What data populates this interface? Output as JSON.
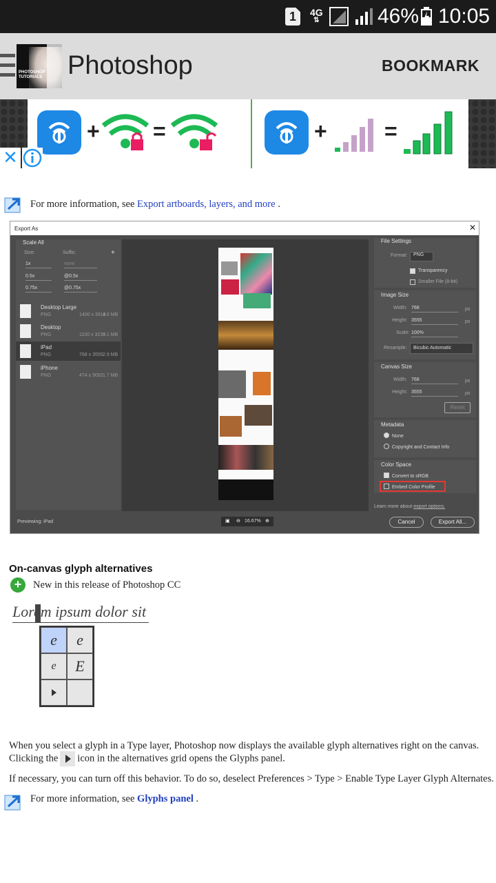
{
  "status_bar": {
    "sim": "1",
    "network": "4G",
    "battery": "46%",
    "time": "10:05"
  },
  "app_bar": {
    "title": "Photoshop",
    "bookmark": "BOOKMARK",
    "thumb_text": "PHOTOSHOP TUTORIALS"
  },
  "ad": {
    "close": "✕",
    "op_plus": "+",
    "op_equals": "="
  },
  "export_info": {
    "prefix": "For more information, see",
    "link": "Export artboards, layers, and more",
    "suffix": "."
  },
  "export_dialog": {
    "title": "Export As",
    "scale_all": "Scale All",
    "size_label": "Size:",
    "suffix_label": "Suffix:",
    "scales": [
      {
        "size": "1x",
        "suffix": "none"
      },
      {
        "size": "0.5x",
        "suffix": "@0.5x"
      },
      {
        "size": "0.75x",
        "suffix": "@0.75x"
      }
    ],
    "presets": [
      {
        "name": "Desktop Large",
        "format": "PNG",
        "size": "1400 x 3918",
        "mb": "4.6 MB"
      },
      {
        "name": "Desktop",
        "format": "PNG",
        "size": "1100 x 3239",
        "mb": "3.1 MB"
      },
      {
        "name": "iPad",
        "format": "PNG",
        "size": "768 x 3555",
        "mb": "2.9 MB"
      },
      {
        "name": "iPhone",
        "format": "PNG",
        "size": "474 x 9092",
        "mb": "1.7 MB"
      }
    ],
    "file_settings": "File Settings",
    "format_label": "Format:",
    "format_value": "PNG",
    "transparency": "Transparency",
    "smaller_file": "Smaller File (8-bit)",
    "image_size": "Image Size",
    "width_label": "Width:",
    "width_value": "768",
    "height_label": "Height:",
    "height_value": "3555",
    "scale_label": "Scale:",
    "scale_value": "100%",
    "resample_label": "Resample:",
    "resample_value": "Bicubic Automatic",
    "unit": "px",
    "canvas_size": "Canvas Size",
    "canvas_width": "768",
    "canvas_height": "3555",
    "reset": "Reset",
    "metadata": "Metadata",
    "meta_none": "None",
    "meta_copyright": "Copyright and Contact Info",
    "color_space": "Color Space",
    "convert_srgb": "Convert to sRGB",
    "embed_profile": "Embed Color Profile",
    "learn_more": "Learn more about",
    "export_options": "export options.",
    "previewing": "Previewing: iPad",
    "zoom": "16.67%",
    "cancel": "Cancel",
    "export_all": "Export All..."
  },
  "glyph_section": {
    "title": "On-canvas glyph alternatives",
    "new_badge": "+",
    "new_text": "New in this release of Photoshop CC",
    "lorem": "Lorem ipsum dolor sit",
    "glyphs": [
      "e",
      "e",
      "e",
      "E"
    ],
    "para1_line1": "When you select a glyph in a Type layer, Photoshop now displays the available glyph alternatives right on the canvas.",
    "para1_line2_a": "Clicking the",
    "para1_line2_b": "icon in the alternatives grid opens the Glyphs panel.",
    "para2": "If necessary, you can turn off this behavior. To do so, deselect Preferences > Type > Enable Type Layer Glyph Alternates.",
    "info_prefix": "For more information, see",
    "info_link": "Glyphs panel",
    "info_suffix": "."
  }
}
